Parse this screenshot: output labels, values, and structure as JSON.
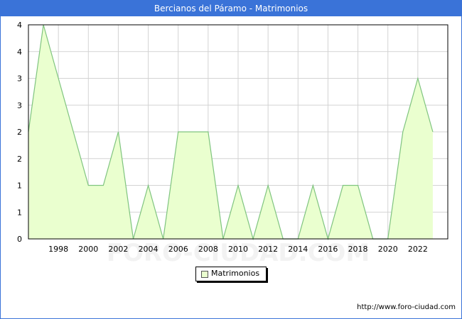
{
  "window": {
    "title": "Bercianos del Páramo - Matrimonios"
  },
  "footer": {
    "url": "http://www.foro-ciudad.com"
  },
  "watermark": "FORO-CIUDAD.COM",
  "colors": {
    "title_bar": "#3a73d8",
    "fill": "#eaffcf",
    "line": "#7fc47f",
    "grid": "#d3d3d3"
  },
  "chart_data": {
    "type": "area",
    "title": "Bercianos del Páramo - Matrimonios",
    "xlabel": "",
    "ylabel": "",
    "x": [
      1996,
      1997,
      1998,
      1999,
      2000,
      2001,
      2002,
      2003,
      2004,
      2005,
      2006,
      2007,
      2008,
      2009,
      2010,
      2011,
      2012,
      2013,
      2014,
      2015,
      2016,
      2017,
      2018,
      2019,
      2020,
      2021,
      2022,
      2023
    ],
    "series": [
      {
        "name": "Matrimonios",
        "values": [
          2,
          4,
          3,
          2,
          1,
          1,
          2,
          0,
          1,
          0,
          2,
          2,
          2,
          0,
          1,
          0,
          1,
          0,
          0,
          1,
          0,
          1,
          1,
          0,
          0,
          2,
          3,
          2
        ]
      }
    ],
    "xlim": [
      1996,
      2024
    ],
    "ylim": [
      0,
      4
    ],
    "x_tick_labels": [
      "1998",
      "2000",
      "2002",
      "2004",
      "2006",
      "2008",
      "2010",
      "2012",
      "2014",
      "2016",
      "2018",
      "2020",
      "2022"
    ],
    "y_tick_labels": [
      "0",
      "1",
      "1",
      "2",
      "2",
      "3",
      "3",
      "4",
      "4"
    ],
    "grid": true,
    "legend": {
      "position": "bottom-center",
      "entries": [
        "Matrimonios"
      ]
    }
  }
}
